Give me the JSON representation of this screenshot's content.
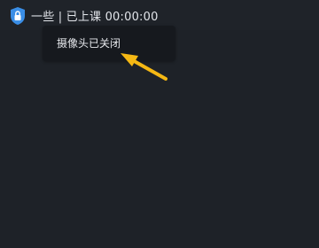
{
  "titlebar": {
    "icon": "shield-lock-icon",
    "status_text": "一些 | 已上课 00:00:00"
  },
  "toast": {
    "message": "摄像头已关闭"
  },
  "annotation": {
    "icon": "arrow-pointer-icon",
    "color": "#f5b814"
  },
  "colors": {
    "background": "#1e2228",
    "shield": "#3a8ee6"
  }
}
